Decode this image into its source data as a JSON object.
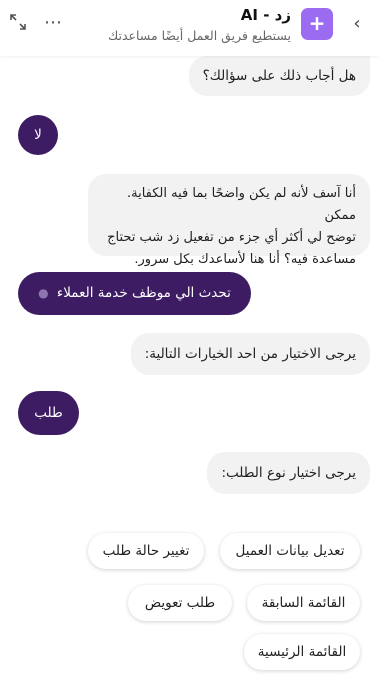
{
  "header": {
    "title": "زد - AI",
    "subtitle": "يستطيع فريق العمل أيضًا مساعدتك",
    "logo_glyph": "+",
    "back_icon": "chevron-left-icon",
    "more_icon": "more-horizontal-icon",
    "expand_icon": "expand-icon"
  },
  "messages": [
    {
      "role": "bot",
      "text": "هل أجاب ذلك على سؤالك؟"
    },
    {
      "role": "user",
      "text": "لا"
    },
    {
      "role": "bot",
      "lines": [
        "أنا آسف لأنه لم يكن واضحًا بما فيه الكفاية. ممكن",
        "توضح لي أكثر أي جزء من تفعيل زد شب تحتاج",
        "مساعدة فيه؟ أنا هنا لأساعدك بكل سرور."
      ]
    },
    {
      "role": "user",
      "text": "تحدث الي موظف خدمة العملاء"
    },
    {
      "role": "bot",
      "text": "يرجى الاختيار من احد الخيارات التالية:"
    },
    {
      "role": "user",
      "text": "طلب"
    },
    {
      "role": "bot",
      "text": "يرجى اختيار نوع الطلب:"
    }
  ],
  "options": [
    "تعديل بيانات العميل",
    "تغيير حالة طلب",
    "القائمة السابقة",
    "طلب تعويض",
    "القائمة الرئيسية"
  ],
  "colors": {
    "accent": "#3d1c63",
    "logo": "#9b6cf2",
    "bot_bubble": "#f2f2f2"
  }
}
